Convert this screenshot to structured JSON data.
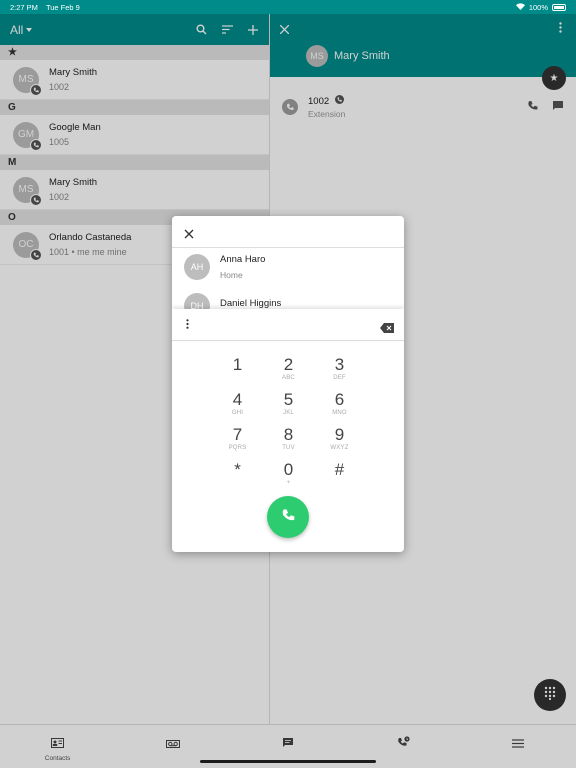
{
  "status": {
    "time": "2:27 PM",
    "date": "Tue Feb 9",
    "battery": "100%"
  },
  "contacts_header": {
    "filter": "All"
  },
  "sections": [
    {
      "letter": "★",
      "contacts": [
        {
          "initials": "MS",
          "name": "Mary Smith",
          "sub": "1002"
        }
      ]
    },
    {
      "letter": "G",
      "contacts": [
        {
          "initials": "GM",
          "name": "Google Man",
          "sub": "1005"
        }
      ]
    },
    {
      "letter": "M",
      "contacts": [
        {
          "initials": "MS",
          "name": "Mary Smith",
          "sub": "1002"
        }
      ]
    },
    {
      "letter": "O",
      "contacts": [
        {
          "initials": "OC",
          "name": "Orlando Castaneda",
          "sub": "1001 • me me mine"
        }
      ]
    }
  ],
  "detail": {
    "initials": "MS",
    "name": "Mary Smith",
    "number": "1002",
    "label": "Extension"
  },
  "dialer": {
    "suggestions": [
      {
        "initials": "AH",
        "name": "Anna Haro",
        "sub": "Home"
      },
      {
        "initials": "DH",
        "name": "Daniel Higgins",
        "sub": ""
      }
    ],
    "keys": [
      {
        "digit": "1",
        "letters": ""
      },
      {
        "digit": "2",
        "letters": "ABC"
      },
      {
        "digit": "3",
        "letters": "DEF"
      },
      {
        "digit": "4",
        "letters": "GHI"
      },
      {
        "digit": "5",
        "letters": "JKL"
      },
      {
        "digit": "6",
        "letters": "MNO"
      },
      {
        "digit": "7",
        "letters": "PQRS"
      },
      {
        "digit": "8",
        "letters": "TUV"
      },
      {
        "digit": "9",
        "letters": "WXYZ"
      },
      {
        "digit": "*",
        "letters": ""
      },
      {
        "digit": "0",
        "letters": "+"
      },
      {
        "digit": "#",
        "letters": ""
      }
    ]
  },
  "tabs": {
    "contacts": "Contacts"
  },
  "colors": {
    "primary": "#008b8b",
    "call": "#2ecc71"
  },
  "icons": {
    "header": [
      "search-icon",
      "sort-icon",
      "add-icon"
    ],
    "tabs": [
      "contacts-icon",
      "voicemail-icon",
      "chat-icon",
      "call-history-icon",
      "menu-icon"
    ]
  }
}
